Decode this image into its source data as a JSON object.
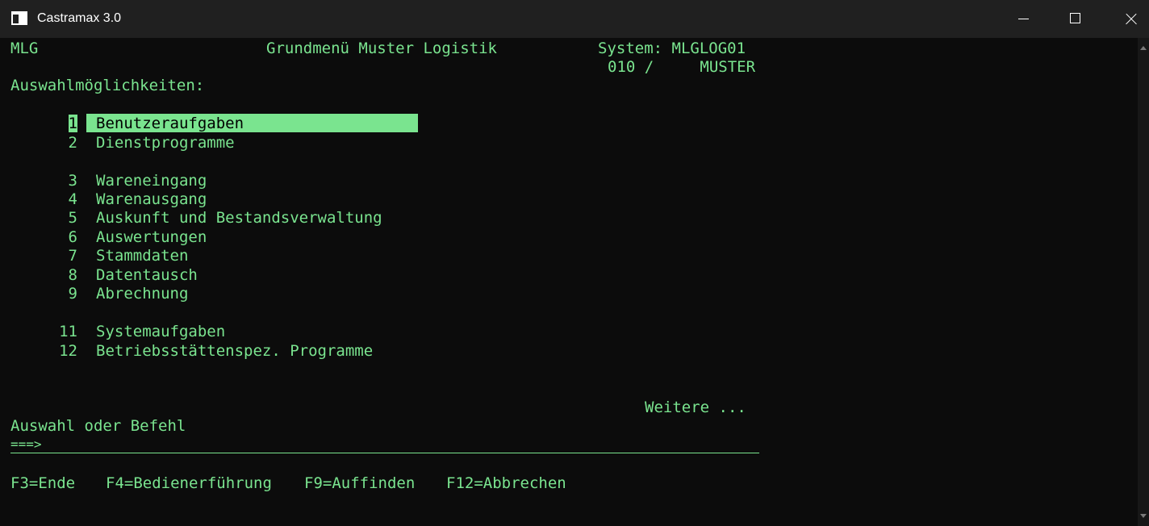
{
  "window": {
    "title": "Castramax 3.0",
    "icon": "terminal-window-icon"
  },
  "header": {
    "left": "MLG",
    "title": "Grundmenü Muster Logistik",
    "system": "System: MLGLOG01",
    "session": "010 /     MUSTER"
  },
  "prompt": "Auswahlmöglichkeiten:",
  "menu": [
    {
      "num": "1",
      "label": "Benutzeraufgaben"
    },
    {
      "num": "2",
      "label": "Dienstprogramme"
    },
    {
      "num": "3",
      "label": "Wareneingang"
    },
    {
      "num": "4",
      "label": "Warenausgang"
    },
    {
      "num": "5",
      "label": "Auskunft und Bestandsverwaltung"
    },
    {
      "num": "6",
      "label": "Auswertungen"
    },
    {
      "num": "7",
      "label": "Stammdaten"
    },
    {
      "num": "8",
      "label": "Datentausch"
    },
    {
      "num": "9",
      "label": "Abrechnung"
    },
    {
      "num": "11",
      "label": "Systemaufgaben"
    },
    {
      "num": "12",
      "label": "Betriebsstättenspez. Programme"
    }
  ],
  "more": "Weitere ...",
  "command": {
    "label": "Auswahl oder Befehl",
    "prompt": "===>",
    "value": ""
  },
  "function_keys": [
    "F3=Ende",
    "F4=Bedienerführung",
    "F9=Auffinden",
    "F12=Abbrechen"
  ],
  "colors": {
    "foreground": "#7ae48f",
    "background": "#0c0c0c",
    "titlebar": "#202020"
  }
}
